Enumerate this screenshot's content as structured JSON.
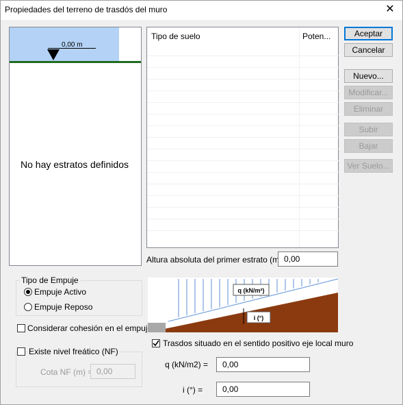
{
  "window": {
    "title": "Propiedades del terreno de trasdós del muro",
    "close_glyph": "✕"
  },
  "preview": {
    "water_label": "0,00 m",
    "empty_message": "No hay estratos definidos"
  },
  "soil_table": {
    "col_type": "Tipo de suelo",
    "col_power": "Poten..."
  },
  "buttons": {
    "accept": "Aceptar",
    "cancel": "Cancelar",
    "new": "Nuevo...",
    "modify": "Modificar...",
    "delete": "Eliminar",
    "up": "Subir",
    "down": "Bajar",
    "view_soil": "Ver Suelo..."
  },
  "altitude": {
    "label": "Altura absoluta del primer estrato (m):",
    "value": "0,00"
  },
  "thrust": {
    "group_label": "Tipo de Empuje",
    "active": "Empuje Activo",
    "rest": "Empuje Reposo",
    "selected": "active"
  },
  "cohesion": {
    "label": "Considerar cohesión en el empuje",
    "checked": false
  },
  "phreatic": {
    "label": "Existe nivel freático (NF)",
    "checked": false,
    "cota_label": "Cota NF (m) =",
    "cota_value": "0,00"
  },
  "diagram": {
    "q_label": "q (kN/m²)",
    "i_label": "i (°)"
  },
  "backfill": {
    "label": "Trasdos situado en el sentido positivo eje local muro",
    "checked": true
  },
  "q": {
    "label": "q (kN/m2) =",
    "value": "0,00"
  },
  "i": {
    "label": "i (°) =",
    "value": "0,00"
  },
  "colors": {
    "water": "#b4d2f5",
    "soil": "#8b3a0f",
    "ground_line": "#1f6b1f",
    "load_arrows": "#5b8fd6"
  }
}
